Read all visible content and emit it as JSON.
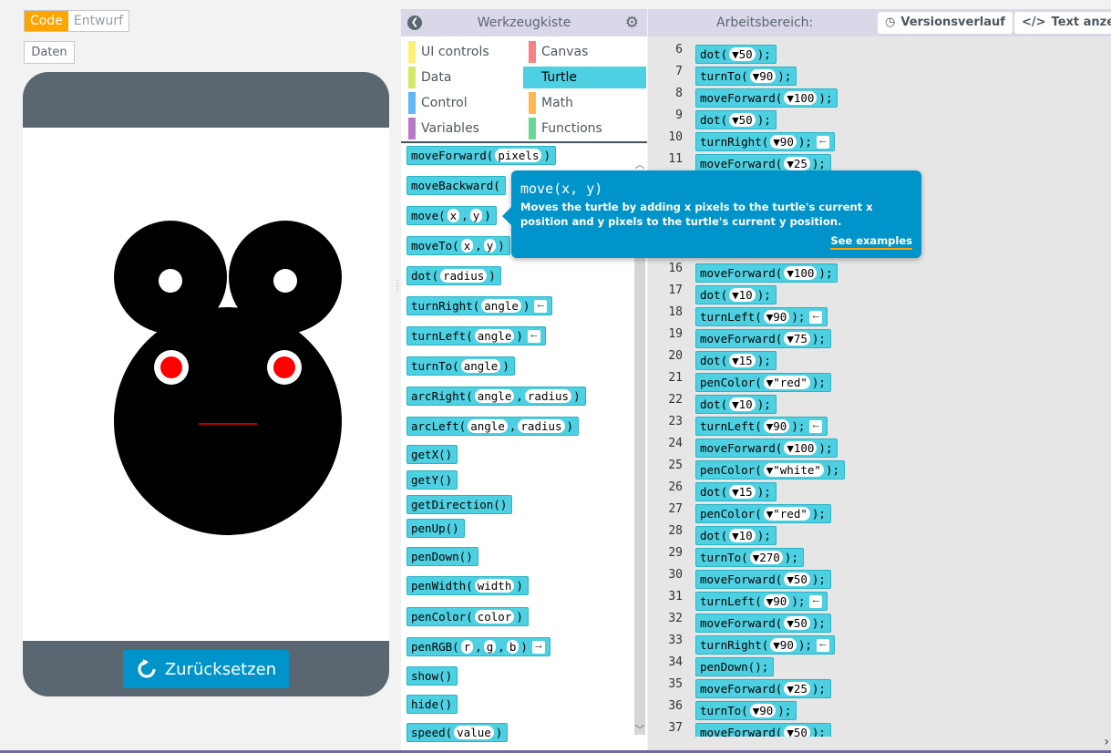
{
  "mode_toggle": {
    "code": "Code",
    "design": "Entwurf"
  },
  "data_button": "Daten",
  "app": {
    "reset_label": "Zurücksetzen",
    "drawing_colors": {
      "face": "#000000",
      "eye_white": "#ffffff",
      "pupil": "#ff0000",
      "mouth": "#b40000"
    }
  },
  "toolbox": {
    "title": "Werkzeugkiste",
    "categories": [
      {
        "label": "UI controls",
        "color": "#fff176"
      },
      {
        "label": "Canvas",
        "color": "#f78183"
      },
      {
        "label": "Data",
        "color": "#d3e965"
      },
      {
        "label": "Turtle",
        "color": "#4dd0e1",
        "selected": true
      },
      {
        "label": "Control",
        "color": "#64b5f6"
      },
      {
        "label": "Math",
        "color": "#ffb74d"
      },
      {
        "label": "Variables",
        "color": "#bb77c7"
      },
      {
        "label": "Functions",
        "color": "#68d995"
      }
    ],
    "blocks": [
      {
        "name": "moveForward(",
        "args": [
          "pixels"
        ],
        "tail": ")"
      },
      {
        "name": "moveBackward(",
        "args": [],
        "tail": ""
      },
      {
        "name": "move(",
        "args": [
          "x",
          "y"
        ],
        "tail": ")"
      },
      {
        "name": "moveTo(",
        "args": [
          "x",
          "y"
        ],
        "tail": ")"
      },
      {
        "name": "dot(",
        "args": [
          "radius"
        ],
        "tail": ")"
      },
      {
        "name": "turnRight(",
        "args": [
          "angle"
        ],
        "tail": ")",
        "ret": true
      },
      {
        "name": "turnLeft(",
        "args": [
          "angle"
        ],
        "tail": ")",
        "ret": true
      },
      {
        "name": "turnTo(",
        "args": [
          "angle"
        ],
        "tail": ")"
      },
      {
        "name": "arcRight(",
        "args": [
          "angle",
          "radius"
        ],
        "tail": ")"
      },
      {
        "name": "arcLeft(",
        "args": [
          "angle",
          "radius"
        ],
        "tail": ")"
      },
      {
        "name": "getX()",
        "args": [],
        "tail": ""
      },
      {
        "name": "getY()",
        "args": [],
        "tail": ""
      },
      {
        "name": "getDirection()",
        "args": [],
        "tail": ""
      },
      {
        "name": "penUp()",
        "args": [],
        "tail": ""
      },
      {
        "name": "penDown()",
        "args": [],
        "tail": ""
      },
      {
        "name": "penWidth(",
        "args": [
          "width"
        ],
        "tail": ")"
      },
      {
        "name": "penColor(",
        "args": [
          "color"
        ],
        "tail": ")"
      },
      {
        "name": "penRGB(",
        "args": [
          "r",
          "g",
          "b"
        ],
        "tail": ")",
        "ret2": true
      },
      {
        "name": "show()",
        "args": [],
        "tail": ""
      },
      {
        "name": "hide()",
        "args": [],
        "tail": ""
      },
      {
        "name": "speed(",
        "args": [
          "value"
        ],
        "tail": ")"
      }
    ]
  },
  "workspace": {
    "title": "Arbeitsbereich:",
    "version_history": "Versionsverlauf",
    "show_text": "Text anzeig",
    "lines": [
      {
        "n": "6",
        "fn": "dot(",
        "val": "50",
        "end": ");"
      },
      {
        "n": "7",
        "fn": "turnTo(",
        "val": "90",
        "end": ");"
      },
      {
        "n": "8",
        "fn": "moveForward(",
        "val": "100",
        "end": ");"
      },
      {
        "n": "9",
        "fn": "dot(",
        "val": "50",
        "end": ");"
      },
      {
        "n": "10",
        "fn": "turnRight(",
        "val": "90",
        "end": ");",
        "ret": true
      },
      {
        "n": "11",
        "fn": "moveForward(",
        "val": "25",
        "end": ");"
      },
      {
        "n": "16",
        "fn": "moveForward(",
        "val": "100",
        "end": ");"
      },
      {
        "n": "17",
        "fn": "dot(",
        "val": "10",
        "end": ");"
      },
      {
        "n": "18",
        "fn": "turnLeft(",
        "val": "90",
        "end": ");",
        "ret": true
      },
      {
        "n": "19",
        "fn": "moveForward(",
        "val": "75",
        "end": ");"
      },
      {
        "n": "20",
        "fn": "dot(",
        "val": "15",
        "end": ");"
      },
      {
        "n": "21",
        "fn": "penColor(",
        "val": "\"red\"",
        "end": ");"
      },
      {
        "n": "22",
        "fn": "dot(",
        "val": "10",
        "end": ");"
      },
      {
        "n": "23",
        "fn": "turnLeft(",
        "val": "90",
        "end": ");",
        "ret": true
      },
      {
        "n": "24",
        "fn": "moveForward(",
        "val": "100",
        "end": ");"
      },
      {
        "n": "25",
        "fn": "penColor(",
        "val": "\"white\"",
        "end": ");"
      },
      {
        "n": "26",
        "fn": "dot(",
        "val": "15",
        "end": ");"
      },
      {
        "n": "27",
        "fn": "penColor(",
        "val": "\"red\"",
        "end": ");"
      },
      {
        "n": "28",
        "fn": "dot(",
        "val": "10",
        "end": ");"
      },
      {
        "n": "29",
        "fn": "turnTo(",
        "val": "270",
        "end": ");"
      },
      {
        "n": "30",
        "fn": "moveForward(",
        "val": "50",
        "end": ");"
      },
      {
        "n": "31",
        "fn": "turnLeft(",
        "val": "90",
        "end": ");",
        "ret": true
      },
      {
        "n": "32",
        "fn": "moveForward(",
        "val": "50",
        "end": ");"
      },
      {
        "n": "33",
        "fn": "turnRight(",
        "val": "90",
        "end": ");",
        "ret": true
      },
      {
        "n": "34",
        "fn": "penDown();",
        "val": null,
        "end": ""
      },
      {
        "n": "35",
        "fn": "moveForward(",
        "val": "25",
        "end": ");"
      },
      {
        "n": "36",
        "fn": "turnTo(",
        "val": "90",
        "end": ");"
      },
      {
        "n": "37",
        "fn": "moveForward(",
        "val": "50",
        "end": ");"
      }
    ]
  },
  "tooltip": {
    "signature": "move(x, y)",
    "description": "Moves the turtle by adding x pixels to the turtle's current x position and y pixels to the turtle's current y position.",
    "link": "See examples"
  }
}
